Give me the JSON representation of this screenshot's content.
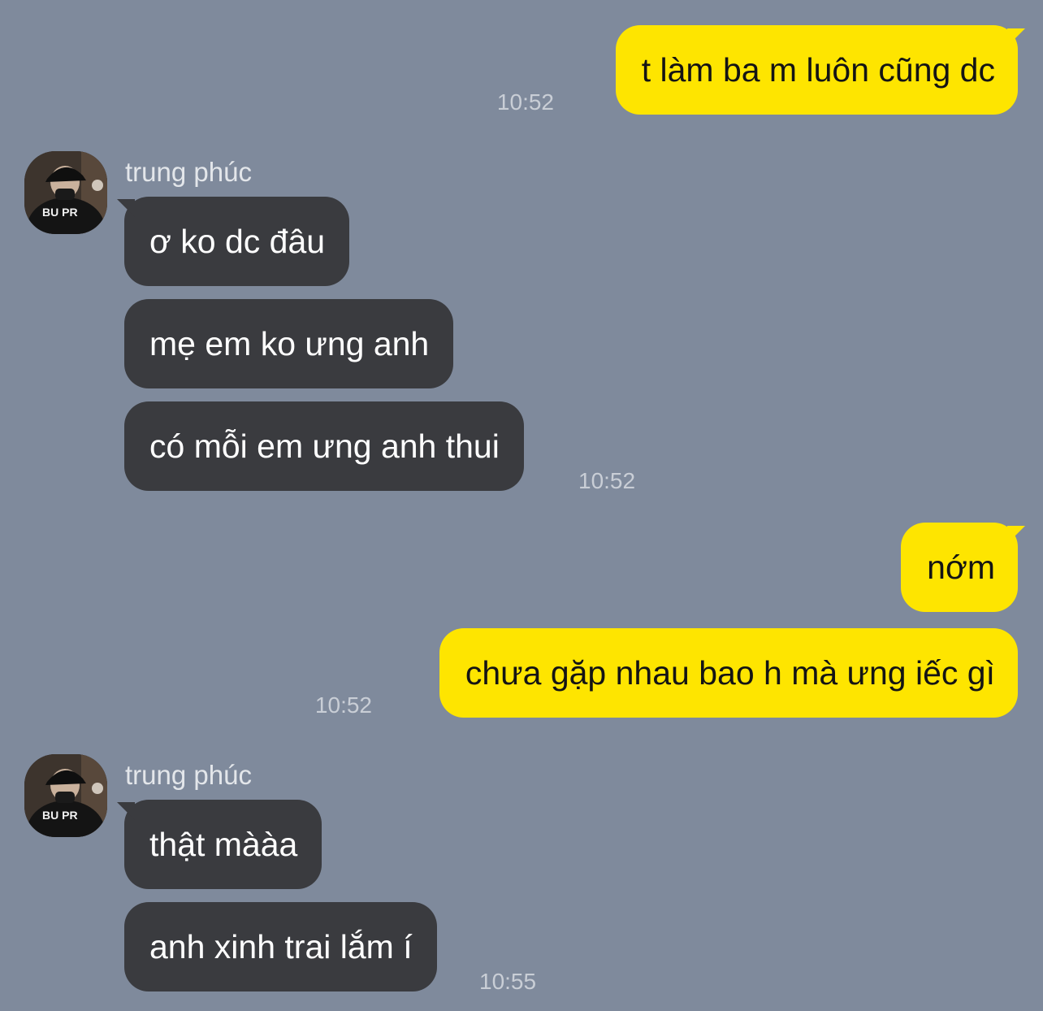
{
  "contact": {
    "name": "trung phúc"
  },
  "messages": [
    {
      "side": "sent",
      "text": "t làm ba m luôn cũng dc",
      "time": "10:52"
    },
    {
      "side": "received",
      "text": "ơ ko dc đâu"
    },
    {
      "side": "received",
      "text": "mẹ em ko ưng anh"
    },
    {
      "side": "received",
      "text": "có mỗi em ưng anh thui",
      "time": "10:52"
    },
    {
      "side": "sent",
      "text": "nớm"
    },
    {
      "side": "sent",
      "text": "chưa gặp nhau bao h mà ưng iếc gì",
      "time": "10:52"
    },
    {
      "side": "received",
      "text": "thật mààa"
    },
    {
      "side": "received",
      "text": "anh xinh trai lắm í",
      "time": "10:55"
    }
  ],
  "colors": {
    "background": "#7f8a9c",
    "sent_bubble": "#fee500",
    "received_bubble": "#3a3b3f",
    "timestamp": "#c9ced6"
  },
  "icons": {
    "avatar": "profile-photo"
  }
}
